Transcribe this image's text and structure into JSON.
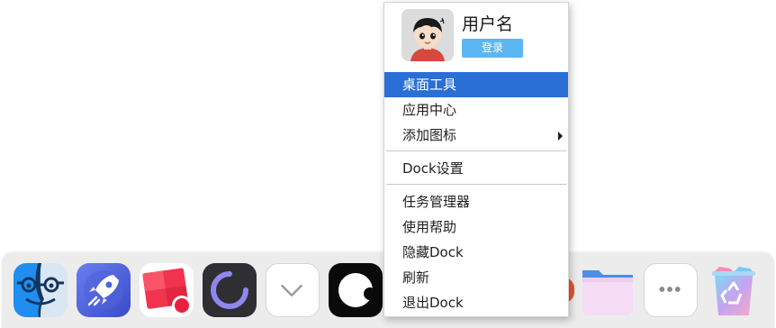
{
  "menu": {
    "user": {
      "avatar_icon": "user-avatar-icon",
      "name": "用户名",
      "login_label": "登录"
    },
    "items": [
      {
        "label": "桌面工具",
        "highlighted": true
      },
      {
        "label": "应用中心"
      },
      {
        "label": "添加图标",
        "has_submenu": true
      },
      {
        "label": "Dock设置"
      },
      {
        "label": "任务管理器"
      },
      {
        "label": "使用帮助"
      },
      {
        "label": "隐藏Dock"
      },
      {
        "label": "刷新"
      },
      {
        "label": "退出Dock"
      }
    ]
  },
  "dock": {
    "icons": [
      {
        "name": "finder-icon"
      },
      {
        "name": "launchpad-rocket-icon"
      },
      {
        "name": "screen-recorder-icon"
      },
      {
        "name": "loading-ring-app-icon"
      },
      {
        "name": "chevron-down-icon"
      },
      {
        "name": "black-circle-app-icon"
      },
      {
        "name": "folder-icon"
      },
      {
        "name": "more-icon"
      },
      {
        "name": "recycle-bin-icon"
      }
    ]
  },
  "colors": {
    "menu_highlight": "#2a6fd6",
    "login_button": "#5cb6f1",
    "dock_background": "#ececec"
  }
}
